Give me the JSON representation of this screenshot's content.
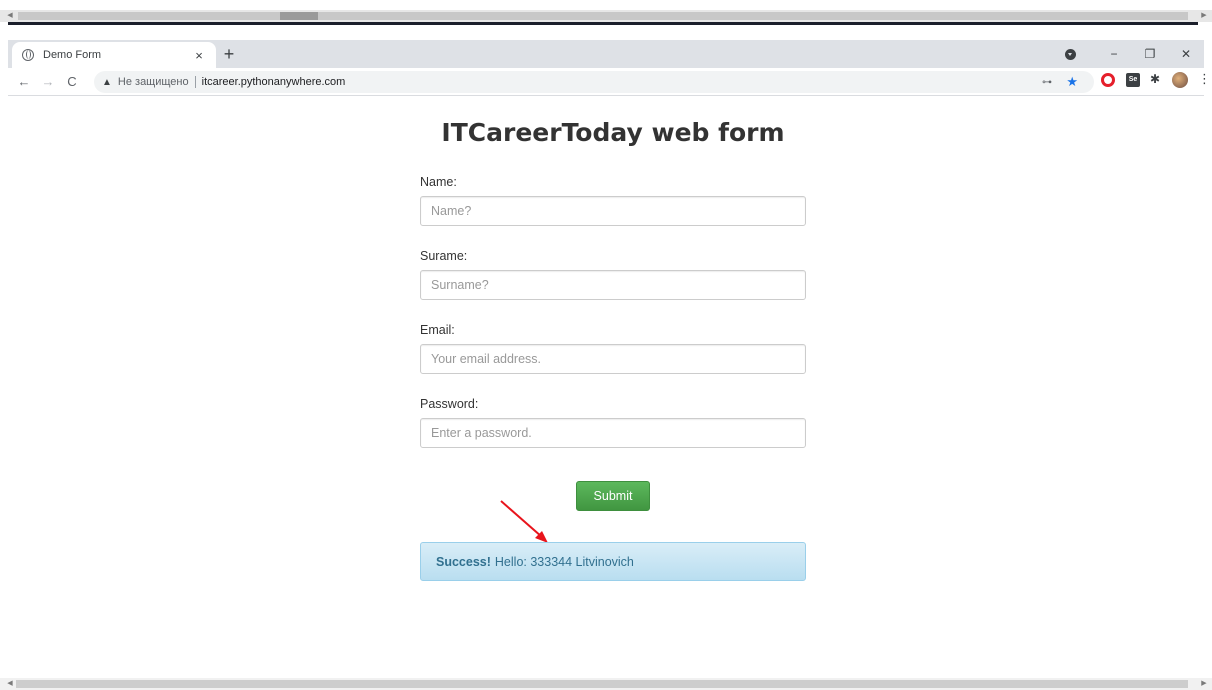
{
  "browser": {
    "tab_title": "Demo Form",
    "tab_close": "×",
    "new_tab": "+",
    "window_controls": {
      "minimize": "−",
      "maximize": "❐",
      "close": "✕"
    },
    "nav": {
      "back": "←",
      "forward": "→",
      "reload": "C"
    },
    "omnibox": {
      "security_icon": "▲",
      "security_text": "Не защищено",
      "url": "itcareer.pythonanywhere.com"
    },
    "extensions": [
      "key-icon",
      "bookmark-star-icon",
      "opera-icon",
      "selenium-ide-icon",
      "extensions-puzzle-icon",
      "profile-avatar",
      "more-menu-icon"
    ],
    "extension_labels": {
      "selenium": "Se",
      "menu": "⋮",
      "key": "⊶",
      "star": "★",
      "puzzle": "✱"
    }
  },
  "page": {
    "title": "ITCareerToday web form",
    "fields": [
      {
        "label": "Name:",
        "placeholder": "Name?"
      },
      {
        "label": "Surame:",
        "placeholder": "Surname?"
      },
      {
        "label": "Email:",
        "placeholder": "Your email address."
      },
      {
        "label": "Password:",
        "placeholder": "Enter a password."
      }
    ],
    "submit_label": "Submit",
    "alert": {
      "strong": "Success!",
      "message": "Hello: 333344 Litvinovich"
    }
  },
  "colors": {
    "submit_green": "#5cb85c",
    "alert_bg": "#d9edf7",
    "alert_text": "#31708f",
    "annotation_arrow": "#e8141c"
  }
}
